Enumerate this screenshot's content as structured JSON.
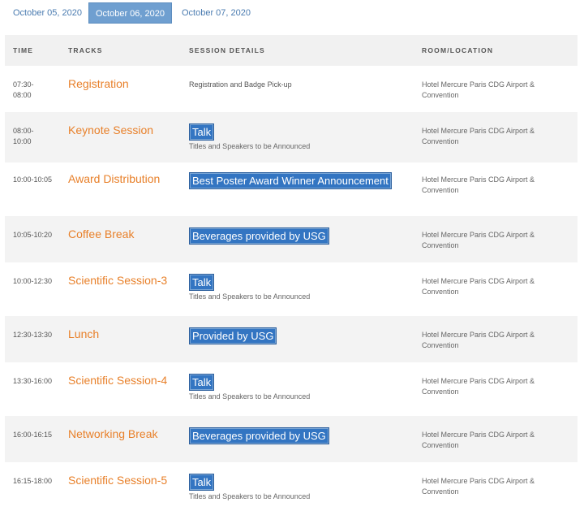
{
  "date_tabs": [
    {
      "label": "October 05, 2020",
      "active": false
    },
    {
      "label": "October 06, 2020",
      "active": true
    },
    {
      "label": "October 07, 2020",
      "active": false
    }
  ],
  "columns": {
    "time": "TIME",
    "tracks": "TRACKS",
    "details": "SESSION DETAILS",
    "room": "ROOM/LOCATION"
  },
  "rows": [
    {
      "time": "07:30-\n08:00",
      "track": "Registration",
      "detail_type": "plain",
      "detail": "Registration and Badge Pick-up",
      "sub": "",
      "room": "Hotel Mercure Paris CDG Airport & Convention"
    },
    {
      "time": "08:00-\n10:00",
      "track": "Keynote Session",
      "detail_type": "badge",
      "detail": "Talk",
      "sub": "Titles and Speakers to be Announced",
      "room": "Hotel Mercure Paris CDG Airport & Convention"
    },
    {
      "time": "10:00-10:05",
      "track": "Award Distribution",
      "detail_type": "badge",
      "detail": "Best Poster Award Winner Announcement",
      "sub": "",
      "room": "Hotel Mercure Paris CDG Airport & Convention"
    },
    {
      "time": "10:05-10:20",
      "track": "Coffee Break",
      "detail_type": "badge",
      "detail": "Beverages provided by USG",
      "sub": "",
      "room": "Hotel Mercure Paris CDG Airport & Convention"
    },
    {
      "time": "10:00-12:30",
      "track": "Scientific Session-3",
      "detail_type": "badge",
      "detail": "Talk",
      "sub": "Titles and Speakers to be Announced",
      "room": "Hotel Mercure Paris CDG Airport & Convention"
    },
    {
      "time": "12:30-13:30",
      "track": "Lunch",
      "detail_type": "badge",
      "detail": "Provided by USG",
      "sub": "",
      "room": "Hotel Mercure Paris CDG Airport & Convention"
    },
    {
      "time": "13:30-16:00",
      "track": "Scientific Session-4",
      "detail_type": "badge",
      "detail": "Talk",
      "sub": "Titles and Speakers to be Announced",
      "room": "Hotel Mercure Paris CDG Airport & Convention"
    },
    {
      "time": "16:00-16:15",
      "track": "Networking Break",
      "detail_type": "badge",
      "detail": "Beverages provided by USG",
      "sub": "",
      "room": "Hotel Mercure Paris CDG Airport & Convention"
    },
    {
      "time": "16:15-18:00",
      "track": "Scientific Session-5",
      "detail_type": "badge",
      "detail": "Talk",
      "sub": "Titles and Speakers to be Announced",
      "room": "Hotel Mercure Paris CDG Airport & Convention"
    }
  ]
}
